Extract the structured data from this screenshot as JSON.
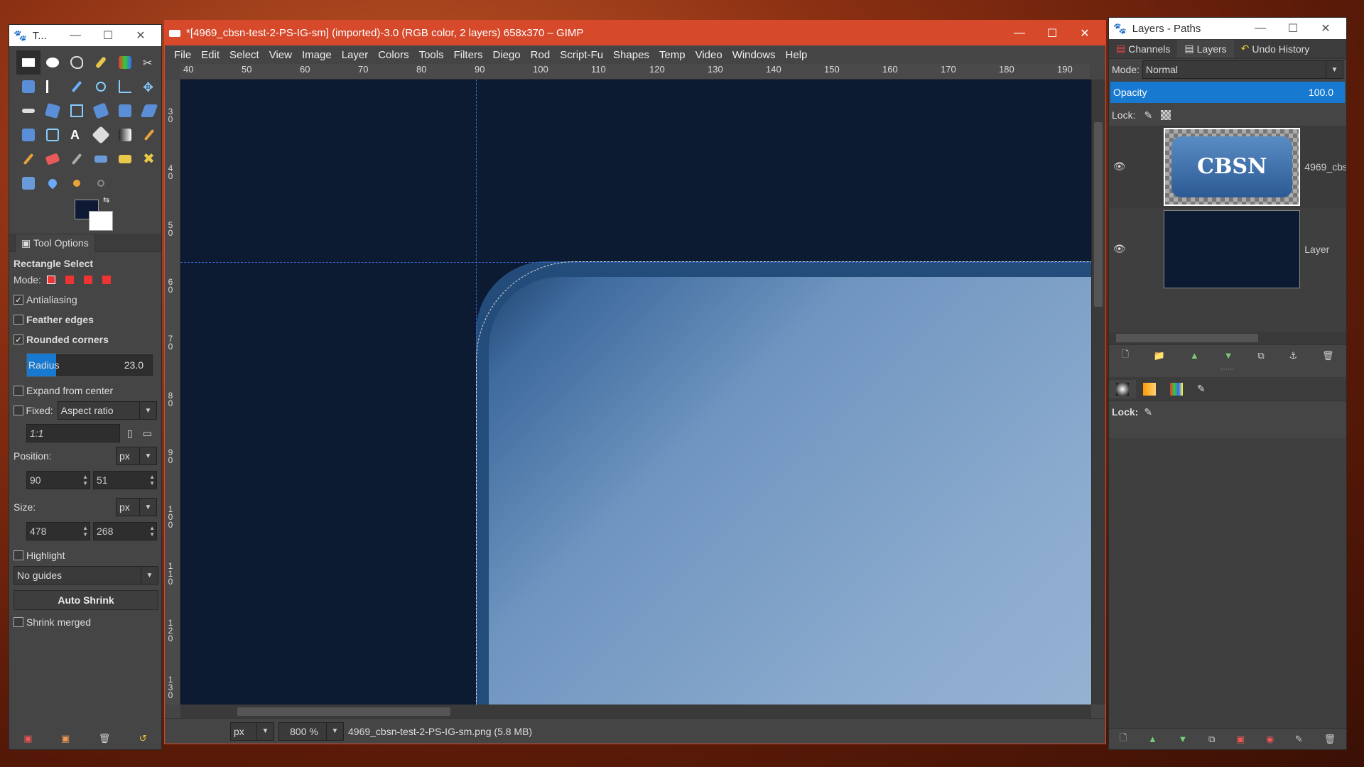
{
  "toolbox": {
    "title": "T...",
    "tool_options_tab": "Tool Options",
    "tool_name": "Rectangle Select",
    "mode_label": "Mode:",
    "antialiasing": "Antialiasing",
    "feather": "Feather edges",
    "rounded": "Rounded corners",
    "radius_label": "Radius",
    "radius_value": "23.0",
    "radius_fraction": 0.23,
    "expand": "Expand from center",
    "fixed": "Fixed:",
    "fixed_value": "Aspect ratio",
    "ratio": "1:1",
    "position_label": "Position:",
    "position_unit": "px",
    "pos_x": "90",
    "pos_y": "51",
    "size_label": "Size:",
    "size_unit": "px",
    "size_w": "478",
    "size_h": "268",
    "highlight": "Highlight",
    "guides": "No guides",
    "auto_shrink": "Auto Shrink",
    "shrink_merged": "Shrink merged"
  },
  "main": {
    "title": "*[4969_cbsn-test-2-PS-IG-sm] (imported)-3.0 (RGB color, 2 layers) 658x370 – GIMP",
    "menu": [
      "File",
      "Edit",
      "Select",
      "View",
      "Image",
      "Layer",
      "Colors",
      "Tools",
      "Filters",
      "Diego",
      "Rod",
      "Script-Fu",
      "Shapes",
      "Temp",
      "Video",
      "Windows",
      "Help"
    ],
    "ruler_h": [
      "40",
      "50",
      "60",
      "70",
      "80",
      "90",
      "100",
      "110",
      "120",
      "130",
      "140",
      "150",
      "160",
      "170",
      "180",
      "190"
    ],
    "ruler_v": [
      "30",
      "40",
      "50",
      "60",
      "70",
      "80",
      "90",
      "100",
      "110",
      "120",
      "130"
    ],
    "status_unit": "px",
    "zoom": "800 %",
    "file_info": "4969_cbsn-test-2-PS-IG-sm.png (5.8 MB)"
  },
  "layers": {
    "title": "Layers - Paths",
    "tabs": [
      "Channels",
      "Layers",
      "Undo History"
    ],
    "mode_label": "Mode:",
    "mode_value": "Normal",
    "opacity_label": "Opacity",
    "opacity_value": "100.0",
    "lock_label": "Lock:",
    "layer1_name": "4969_cbs",
    "layer1_logo": "CBSN",
    "layer2_name": "Layer",
    "paths_lock": "Lock:"
  }
}
